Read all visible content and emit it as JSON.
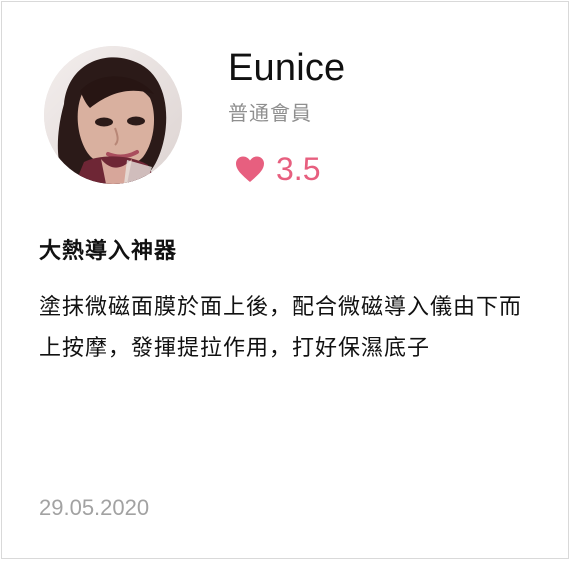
{
  "reviewer": {
    "name": "Eunice",
    "member_level": "普通會員",
    "rating": "3.5",
    "rating_icon": "heart-icon",
    "rating_color": "#e75f7f"
  },
  "review": {
    "title": "大熱導入神器",
    "body": "塗抹微磁面膜於面上後，配合微磁導入儀由下而上按摩，發揮提拉作用，打好保濕底子",
    "date": "29.05.2020"
  }
}
